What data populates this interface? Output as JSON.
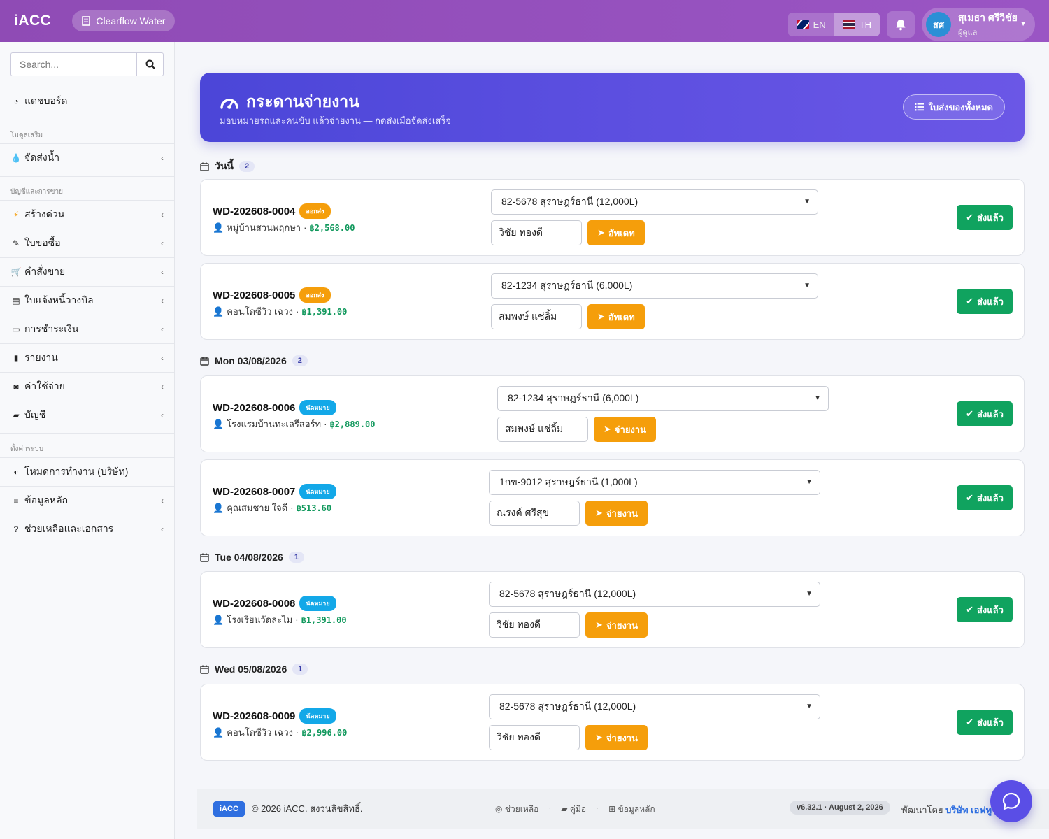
{
  "app": {
    "brand": "iACC",
    "company": "Clearflow Water"
  },
  "header": {
    "lang_en": "EN",
    "lang_th": "TH",
    "user_initials": "สศ",
    "user_name": "สุเมธา ศรีวิชัย",
    "user_role": "ผู้ดูแล"
  },
  "sidebar": {
    "search_placeholder": "Search...",
    "dashboard": "แดชบอร์ด",
    "section_addons": "โมดูลเสริม",
    "water_delivery": "จัดส่งน้ำ",
    "section_accounting": "บัญชีและการขาย",
    "quick_create": "สร้างด่วน",
    "purchase_request": "ใบขอซื้อ",
    "sales_order": "คำสั่งขาย",
    "invoice": "ใบแจ้งหนี้วางบิล",
    "payment": "การชำระเงิน",
    "reports": "รายงาน",
    "expenses": "ค่าใช้จ่าย",
    "accounts": "บัญชี",
    "section_system": "ตั้งค่าระบบ",
    "work_mode": "โหมดการทำงาน (บริษัท)",
    "master_data": "ข้อมูลหลัก",
    "help_docs": "ช่วยเหลือและเอกสาร"
  },
  "hero": {
    "title": "กระดานจ่ายงาน",
    "subtitle": "มอบหมายรถและคนขับ แล้วจ่ายงาน — กดส่งเมื่อจัดส่งเสร็จ",
    "all_button": "ใบส่งของทั้งหมด"
  },
  "groups": [
    {
      "label": "วันนี้",
      "count": "2"
    },
    {
      "label": "Mon 03/08/2026",
      "count": "2"
    },
    {
      "label": "Tue 04/08/2026",
      "count": "1"
    },
    {
      "label": "Wed 05/08/2026",
      "count": "1"
    }
  ],
  "orders": [
    {
      "id": "WD-202608-0004",
      "status": "ออกส่ง",
      "customer": "หมู่บ้านสวนพฤกษา",
      "amount": "฿2,568.00",
      "vehicle": "82-5678 สุราษฎร์ธานี (12,000L)",
      "driver": "วิชัย ทองดี",
      "action": "อัพเดท",
      "done": "ส่งแล้ว"
    },
    {
      "id": "WD-202608-0005",
      "status": "ออกส่ง",
      "customer": "คอนโดซีวิว เฉวง",
      "amount": "฿1,391.00",
      "vehicle": "82-1234 สุราษฎร์ธานี (6,000L)",
      "driver": "สมพงษ์ แช่ลิ้ม",
      "action": "อัพเดท",
      "done": "ส่งแล้ว"
    },
    {
      "id": "WD-202608-0006",
      "status": "นัดหมาย",
      "customer": "โรงแรมบ้านทะเลรีสอร์ท",
      "amount": "฿2,889.00",
      "vehicle": "82-1234 สุราษฎร์ธานี (6,000L)",
      "driver": "สมพงษ์ แช่ลิ้ม",
      "action": "จ่ายงาน",
      "done": "ส่งแล้ว"
    },
    {
      "id": "WD-202608-0007",
      "status": "นัดหมาย",
      "customer": "คุณสมชาย ใจดี",
      "amount": "฿513.60",
      "vehicle": "1กข-9012 สุราษฎร์ธานี (1,000L)",
      "driver": "ณรงค์ ศรีสุข",
      "action": "จ่ายงาน",
      "done": "ส่งแล้ว"
    },
    {
      "id": "WD-202608-0008",
      "status": "นัดหมาย",
      "customer": "โรงเรียนวัดละไม",
      "amount": "฿1,391.00",
      "vehicle": "82-5678 สุราษฎร์ธานี (12,000L)",
      "driver": "วิชัย ทองดี",
      "action": "จ่ายงาน",
      "done": "ส่งแล้ว"
    },
    {
      "id": "WD-202608-0009",
      "status": "นัดหมาย",
      "customer": "คอนโดซีวิว เฉวง",
      "amount": "฿2,996.00",
      "vehicle": "82-5678 สุราษฎร์ธานี (12,000L)",
      "driver": "วิชัย ทองดี",
      "action": "จ่ายงาน",
      "done": "ส่งแล้ว"
    }
  ],
  "footer": {
    "logo": "iACC",
    "copyright": "© 2026 iACC. สงวนลิขสิทธิ์.",
    "help": "ช่วยเหลือ",
    "manual": "คู่มือ",
    "master": "ข้อมูลหลัก",
    "version": "v6.32.1 · August 2, 2026",
    "dev_prefix": "พัฒนาโดย",
    "dev_company": "บริษัท เอฟทู"
  },
  "colors": {
    "header": "#9a55c4",
    "hero": "#5a4ee6",
    "success": "#10a35f",
    "warning": "#f59e0b",
    "info": "#13a8e8"
  }
}
